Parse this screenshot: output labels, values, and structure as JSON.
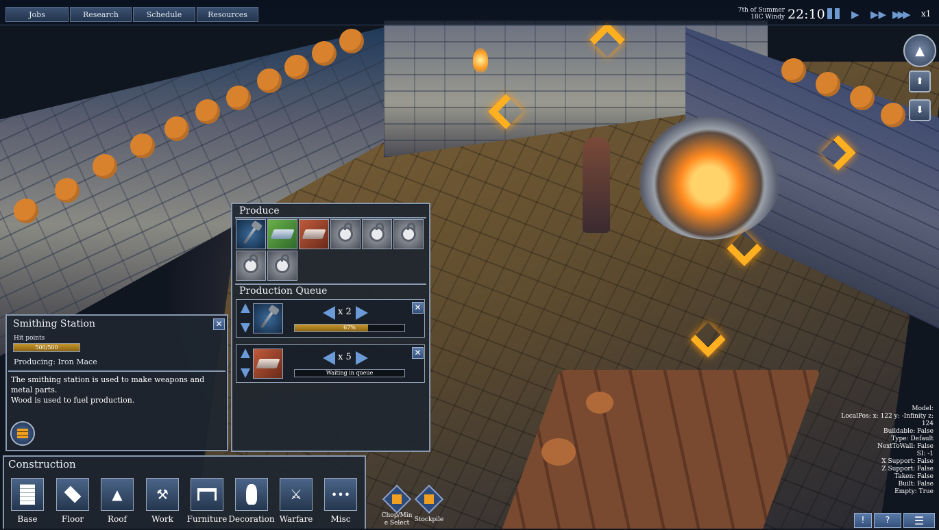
{
  "topbar": {
    "tabs": [
      {
        "label": "Jobs"
      },
      {
        "label": "Research"
      },
      {
        "label": "Schedule"
      },
      {
        "label": "Resources"
      }
    ],
    "date_line1": "7th of Summer",
    "date_line2": "18C Windy",
    "clock": "22:10",
    "speed": "x1"
  },
  "produce": {
    "title": "Produce",
    "queue_title": "Production Queue",
    "queue": [
      {
        "quantity": "x 2",
        "status": "67%",
        "progress": 0.67
      },
      {
        "quantity": "x 5",
        "status": "Waiting in queue",
        "progress": 0
      }
    ]
  },
  "station": {
    "title": "Smithing Station",
    "hp_label": "Hit points",
    "hp_text": "500/500",
    "hp_fraction": 1,
    "producing": "Producing: Iron Mace",
    "description_line1": "The smithing station is used to make weapons and metal parts.",
    "description_line2": "Wood is used to fuel production."
  },
  "construction": {
    "title": "Construction",
    "items": [
      {
        "label": "Base",
        "icon": "base-icon"
      },
      {
        "label": "Floor",
        "icon": "floor-icon"
      },
      {
        "label": "Roof",
        "icon": "roof-icon"
      },
      {
        "label": "Work",
        "icon": "anvil-icon"
      },
      {
        "label": "Furniture",
        "icon": "table-icon"
      },
      {
        "label": "Decoration",
        "icon": "vase-icon"
      },
      {
        "label": "Warfare",
        "icon": "catapult-icon"
      },
      {
        "label": "Misc",
        "icon": "more-icon"
      }
    ]
  },
  "tools": [
    {
      "label_line1": "Chop/Min",
      "label_line2": "e Select"
    },
    {
      "label_line1": "Stockpile",
      "label_line2": ""
    }
  ],
  "debug": {
    "model": "Model:",
    "localpos": "LocalPos: x: 122 y: -Infinity z:",
    "localpos2": "124",
    "buildable": "Buildable: False",
    "type": "Type: Default",
    "nexttowall": "NextToWall: False",
    "si": "SI: -1",
    "xsupport": "X Support: False",
    "zsupport": "Z Support: False",
    "taken": "Taken: False",
    "built": "Built: False",
    "empty": "Empty: True"
  },
  "bottom_buttons": [
    "!",
    "?"
  ]
}
